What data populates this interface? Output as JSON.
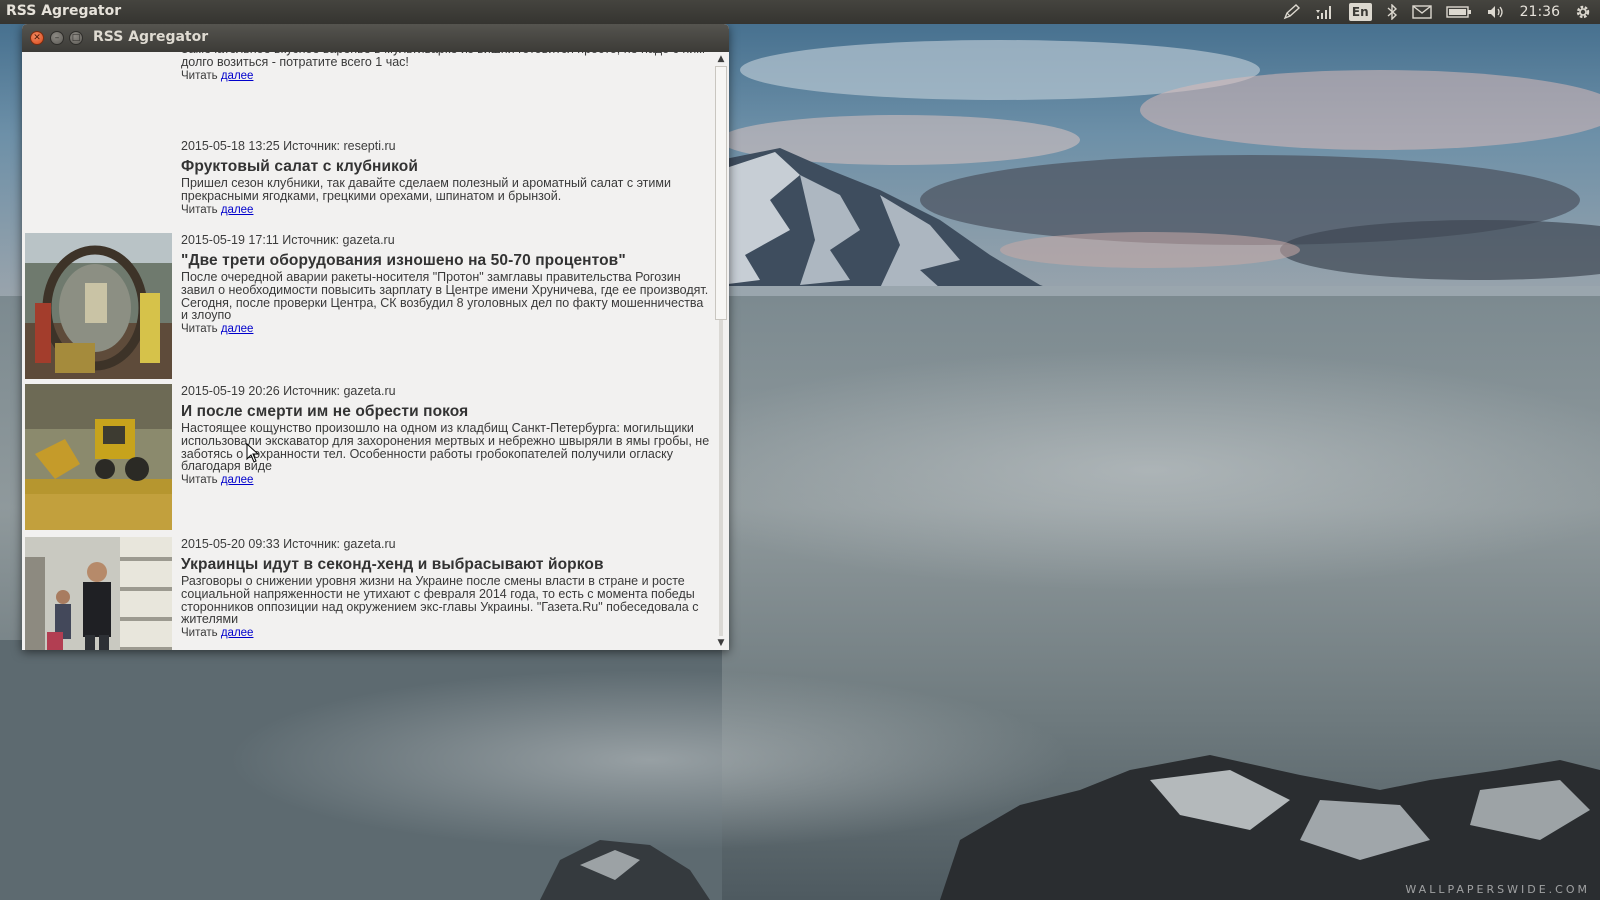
{
  "panel": {
    "app_title": "RSS Agregator",
    "language": "En",
    "clock": "21:36"
  },
  "window": {
    "title": "RSS Agregator"
  },
  "feed": {
    "read_prefix": "Читать",
    "read_link": "далее",
    "items": [
      {
        "meta": "",
        "title": "",
        "desc": "Замечательное вкусное варенье в мультиварке из вишни готовится просто, не надо с ним долго возиться - потратите всего 1 час!",
        "has_image": false
      },
      {
        "meta": "2015-05-18 13:25 Источник: resepti.ru",
        "title": "Фруктовый салат с клубникой",
        "desc": "Пришел сезон клубники, так давайте сделаем полезный и ароматный салат с этими прекрасными ягодками, грецкими орехами, шпинатом и брынзой.",
        "has_image": false
      },
      {
        "meta": "2015-05-19 17:11 Источник: gazeta.ru",
        "title": "\"Две трети оборудования изношено на 50-70 процентов\"",
        "desc": "После очередной аварии ракеты-носителя \"Протон\" замглавы правительства Рогозин завил о необходимости повысить зарплату в Центре имени Хруничева, где ее производят. Сегодня, после проверки Центра, СК возбудил 8 уголовных дел по факту мошенничества и злоупо",
        "has_image": true
      },
      {
        "meta": "2015-05-19 20:26 Источник: gazeta.ru",
        "title": "И после смерти им не обрести покоя",
        "desc": "Настоящее кощунство произошло на одном из кладбищ Санкт-Петербурга: могильщики использовали экскаватор для захоронения мертвых и небрежно швыряли в ямы гробы, не заботясь о сохранности тел. Особенности работы гробокопателей получили огласку благодаря виде",
        "has_image": true
      },
      {
        "meta": "2015-05-20 09:33 Источник: gazeta.ru",
        "title": "Украинцы идут в секонд-хенд и выбрасывают йорков",
        "desc": "Разговоры о снижении уровня жизни на Украине после смены власти в стране и росте социальной напряженности не утихают с февраля 2014 года, то есть с момента победы сторонников оппозиции над окружением экс-главы Украины. \"Газета.Ru\" побеседовала с жителями",
        "has_image": true
      }
    ]
  },
  "scrollbar": {
    "position_fraction": 0.0
  },
  "wallpaper": {
    "watermark": "WALLPAPERSWIDE.COM"
  },
  "icons": [
    "pencil-icon",
    "network-signal-icon",
    "keyboard-layout-icon",
    "bluetooth-icon",
    "mail-icon",
    "battery-icon",
    "volume-icon",
    "gear-icon"
  ],
  "colors": {
    "panel_bg": "#3c3b37",
    "window_bg": "#f2f1f0",
    "link": "#0000cc",
    "close_button": "#e25b2b"
  }
}
